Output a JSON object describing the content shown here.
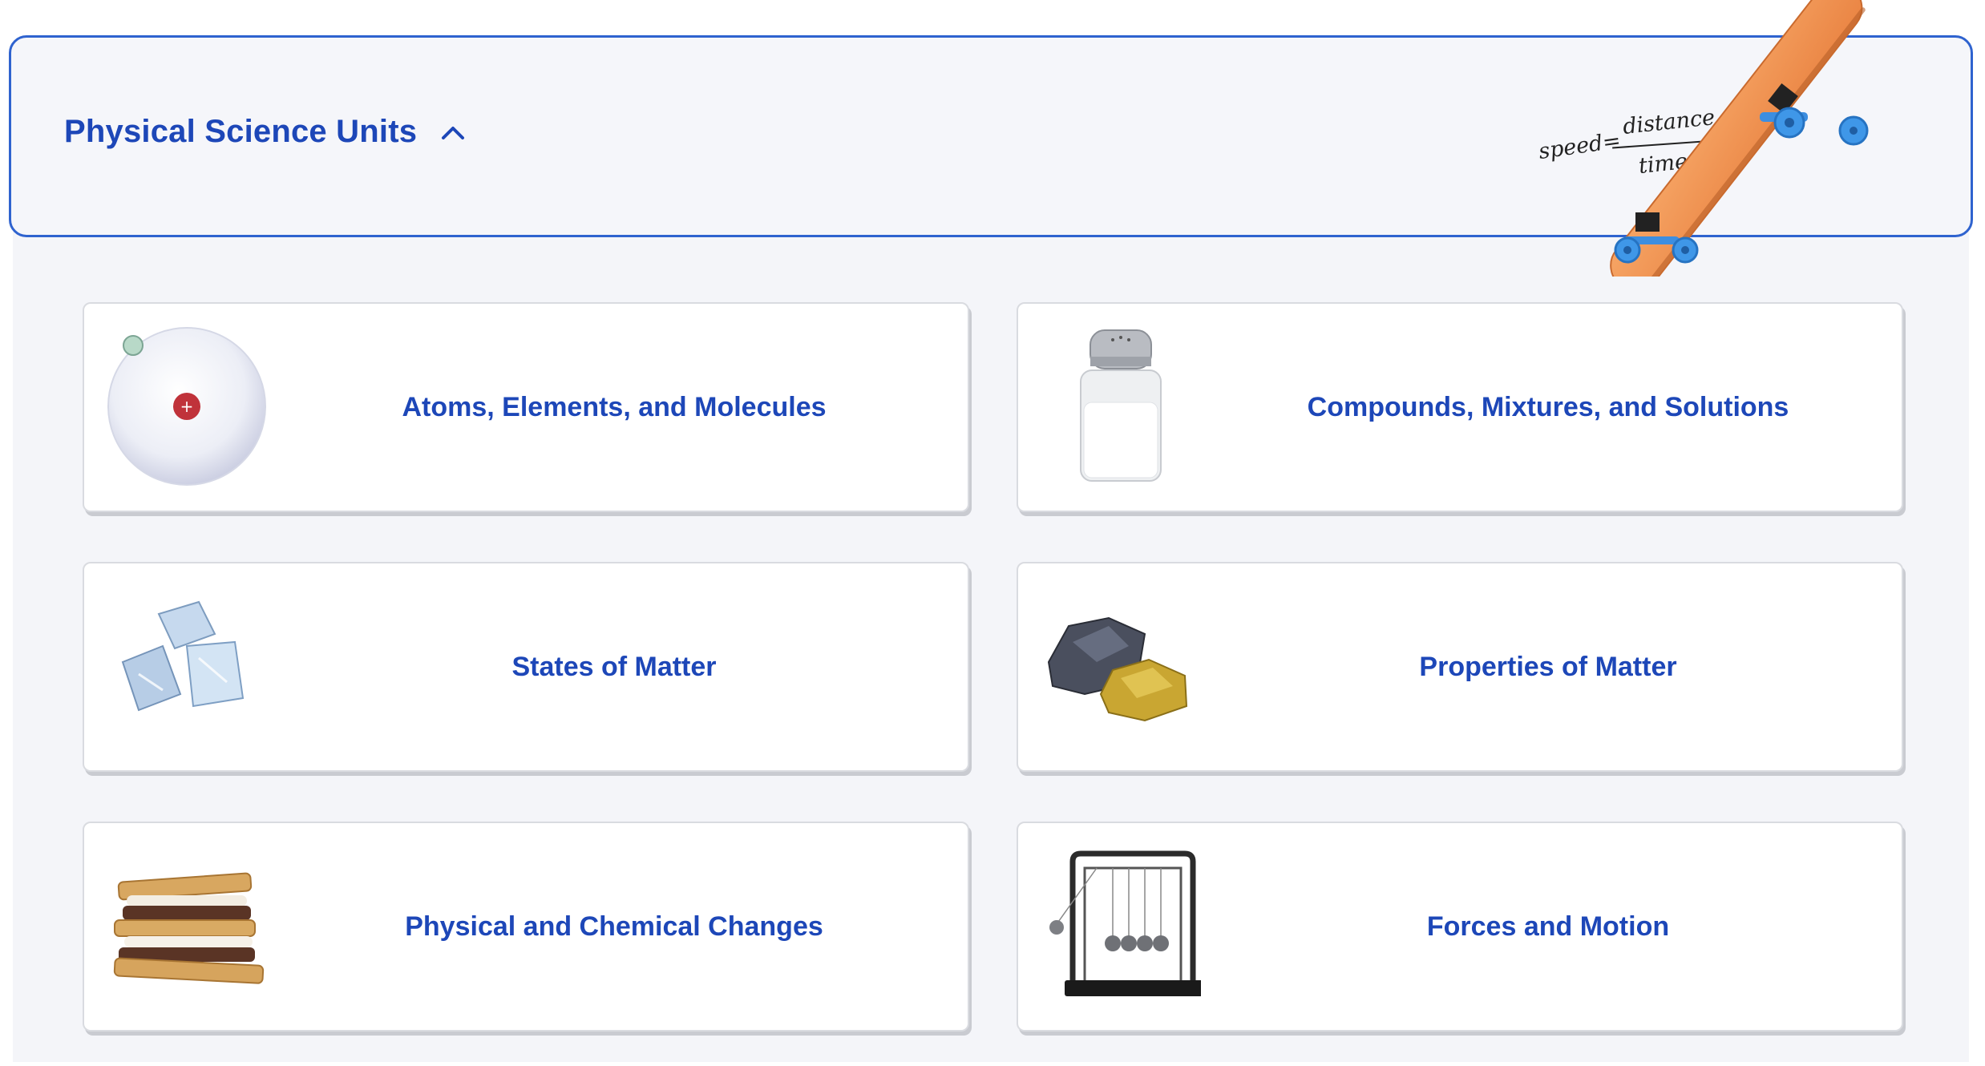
{
  "header": {
    "title": "Physical Science Units",
    "toggle_icon": "chevron-up-icon",
    "formula": {
      "lhs": "speed=",
      "numerator": "distance",
      "denominator": "time"
    },
    "decoration_icon": "skateboard-icon"
  },
  "colors": {
    "accent": "#1d47b8",
    "header_border": "#2f63cf",
    "panel_bg": "#f4f5f9"
  },
  "units": [
    {
      "label": "Atoms, Elements, and Molecules",
      "icon": "atom-icon"
    },
    {
      "label": "Compounds, Mixtures, and Solutions",
      "icon": "salt-shaker-icon"
    },
    {
      "label": "States of Matter",
      "icon": "ice-cubes-icon"
    },
    {
      "label": "Properties of Matter",
      "icon": "rocks-icon"
    },
    {
      "label": "Physical and Chemical Changes",
      "icon": "smores-icon"
    },
    {
      "label": "Forces and Motion",
      "icon": "newtons-cradle-icon"
    }
  ]
}
